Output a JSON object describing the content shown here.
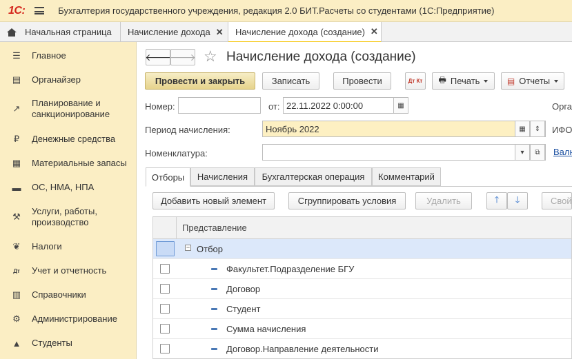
{
  "app": {
    "logo": "1С:",
    "title": "Бухгалтерия государственного учреждения, редакция 2.0 БИТ.Расчеты со студентами  (1С:Предприятие)"
  },
  "window_tabs": [
    {
      "label": "Начальная страница"
    },
    {
      "label": "Начисление дохода"
    },
    {
      "label": "Начисление дохода (создание)"
    }
  ],
  "sidebar": {
    "items": [
      {
        "label": "Главное",
        "icon": "menu-list-icon"
      },
      {
        "label": "Органайзер",
        "icon": "clipboard-icon"
      },
      {
        "label": "Планирование и санкционирование",
        "icon": "chart-icon"
      },
      {
        "label": "Денежные средства",
        "icon": "ruble-coin-icon"
      },
      {
        "label": "Материальные запасы",
        "icon": "grid-icon"
      },
      {
        "label": "ОС, НМА, НПА",
        "icon": "truck-icon"
      },
      {
        "label": "Услуги, работы, производство",
        "icon": "tools-icon"
      },
      {
        "label": "Налоги",
        "icon": "eagle-icon"
      },
      {
        "label": "Учет и отчетность",
        "icon": "debit-credit-icon"
      },
      {
        "label": "Справочники",
        "icon": "books-icon"
      },
      {
        "label": "Администрирование",
        "icon": "gear-icon"
      },
      {
        "label": "Студенты",
        "icon": "graduation-cap-icon"
      }
    ]
  },
  "form": {
    "title": "Начисление дохода (создание)",
    "toolbar": {
      "post_close": "Провести и закрыть",
      "save": "Записать",
      "post": "Провести",
      "dt_kt": "Дт Кт",
      "print": "Печать",
      "reports": "Отчеты"
    },
    "number_label": "Номер:",
    "number_value": "",
    "date_label": "от:",
    "date_value": "22.11.2022  0:00:00",
    "org_label_partial": "Орга",
    "period_label": "Период начисления:",
    "period_value": "Ноябрь 2022",
    "ifo_label_partial": "ИФО",
    "nomenclature_label": "Номенклатура:",
    "nomenclature_value": "",
    "currency_link_partial": "Валн"
  },
  "inner_tabs": [
    {
      "label": "Отборы"
    },
    {
      "label": "Начисления"
    },
    {
      "label": "Бухгалтерская операция"
    },
    {
      "label": "Комментарий"
    }
  ],
  "filter_toolbar": {
    "add": "Добавить новый элемент",
    "group": "Сгруппировать условия",
    "delete": "Удалить",
    "properties_partial": "Свой"
  },
  "grid": {
    "header": "Представление",
    "root": "Отбор",
    "rows": [
      {
        "label": "Факультет.Подразделение БГУ"
      },
      {
        "label": "Договор"
      },
      {
        "label": "Студент"
      },
      {
        "label": "Сумма начисления"
      },
      {
        "label": "Договор.Направление деятельности"
      }
    ]
  }
}
